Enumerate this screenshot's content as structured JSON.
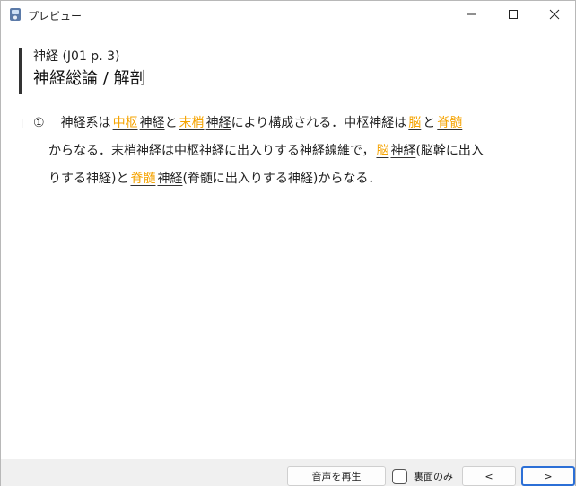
{
  "window": {
    "title": "プレビュー"
  },
  "heading": {
    "subtitle": "神経 (J01 p. 3)",
    "title": "神経総論 / 解剖"
  },
  "item": {
    "checkbox": "□",
    "number": "①",
    "line1": {
      "t1": "神経系は",
      "b1": "中枢",
      "t2": "神経",
      "t3": "と",
      "b2": "末梢",
      "t4": "神経",
      "t5": "により構成される．中枢神経は",
      "b3": "脳",
      "t6": "と",
      "b4": "脊髄"
    },
    "line2": {
      "t1": "からなる．末梢神経は中枢神経に出入りする神経線維で，",
      "b1": "脳",
      "t2": "神経",
      "t3": "(脳幹に出入"
    },
    "line3": {
      "t1": "りする神経)と",
      "b1": "脊髄",
      "t2": "神経",
      "t3": "(脊髄に出入りする神経)からなる．"
    }
  },
  "bottombar": {
    "voice_button": "音声を再生",
    "back_only_label": "裏面のみ",
    "back_only_checked": false,
    "prev_button": "<",
    "next_button": ">"
  },
  "colors": {
    "blank_text": "#f5a300",
    "focus_border": "#2b6fd6"
  }
}
